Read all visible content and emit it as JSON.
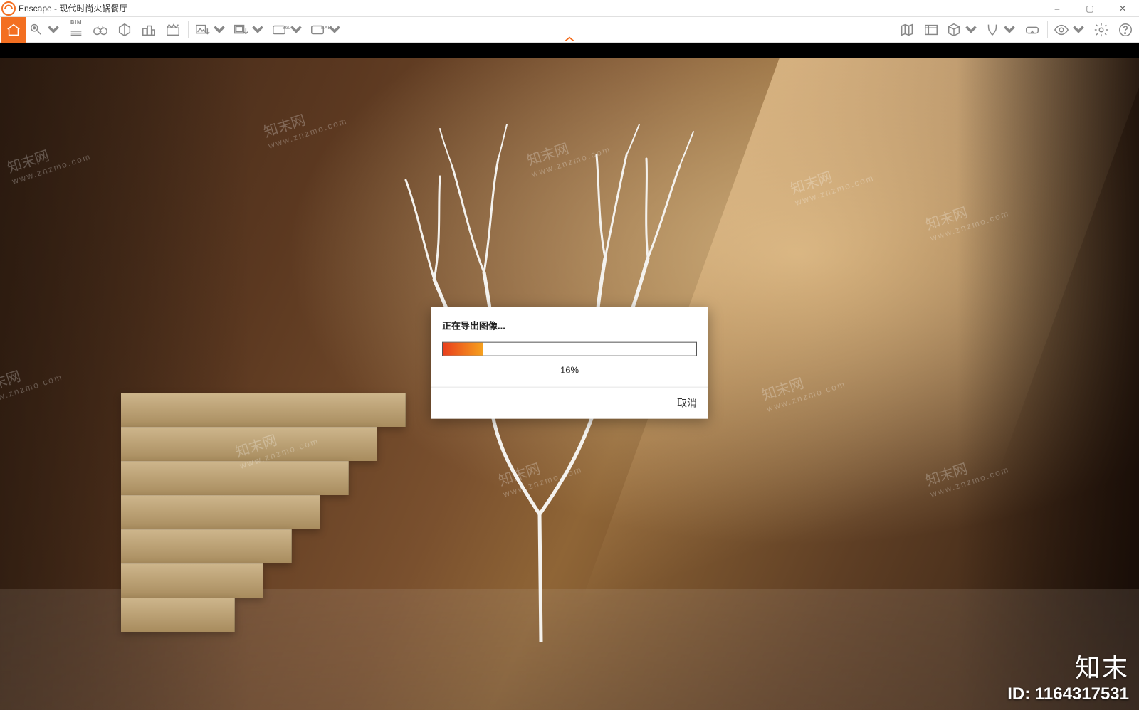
{
  "window": {
    "app_name": "Enscape",
    "title_sep": " - ",
    "project_name": "现代时尚火锅餐厅",
    "controls": {
      "minimize": "–",
      "maximize": "▢",
      "close": "✕"
    }
  },
  "toolbar": {
    "left_icons": [
      "home-icon",
      "pin-icon",
      "bim-icon",
      "binoculars-icon",
      "view-plane-icon",
      "buildings-icon",
      "clapboard-icon"
    ],
    "left_icons2": [
      "export-image-icon",
      "export-video-icon",
      "panorama-360-icon",
      "exe-export-icon"
    ],
    "right_icons": [
      "map-icon",
      "asset-library-icon",
      "cube-icon",
      "perspective-icon",
      "vr-headset-icon",
      "eye-icon",
      "settings-gear-icon",
      "help-icon"
    ],
    "bim_label": "BIM",
    "exe_label": "EXE",
    "pano_label": "360°"
  },
  "dialog": {
    "title": "正在导出图像...",
    "progress_percent": 16,
    "progress_label": "16%",
    "cancel_label": "取消"
  },
  "watermark": {
    "cn": "知末网",
    "en": "www.znzmo.com",
    "brand": "知末",
    "id_label": "ID: 1164317531"
  }
}
